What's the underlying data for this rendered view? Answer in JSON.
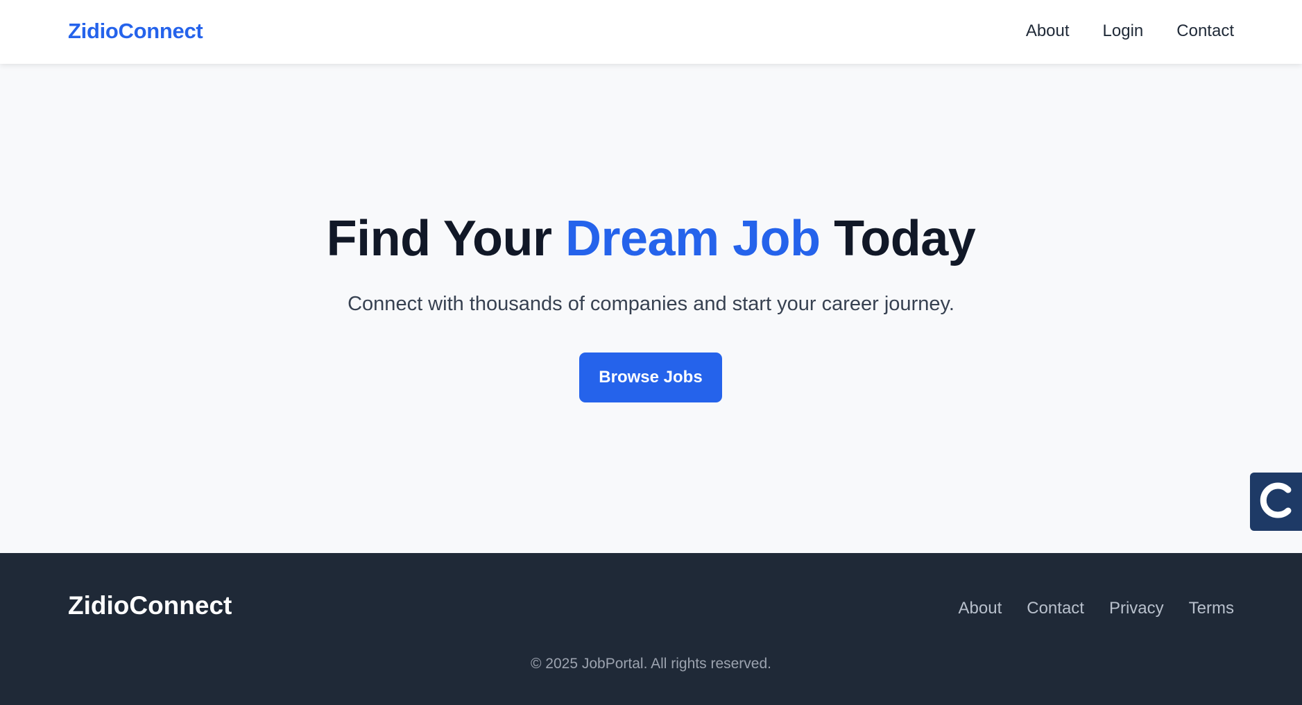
{
  "header": {
    "brand": "ZidioConnect",
    "nav": [
      "About",
      "Login",
      "Contact"
    ]
  },
  "hero": {
    "title_start": "Find Your ",
    "title_accent": "Dream Job",
    "title_end": " Today",
    "subtitle": "Connect with thousands of companies and start your career journey.",
    "cta_label": "Browse Jobs"
  },
  "widget": {
    "icon": "c-logo-icon"
  },
  "footer": {
    "brand": "ZidioConnect",
    "links": [
      "About",
      "Contact",
      "Privacy",
      "Terms"
    ],
    "copyright": "© 2025 JobPortal. All rights reserved."
  },
  "colors": {
    "accent": "#2563eb",
    "header_bg": "#ffffff",
    "page_bg": "#f8f9fb",
    "footer_bg": "#1f2937",
    "widget_bg": "#1e3a66"
  }
}
